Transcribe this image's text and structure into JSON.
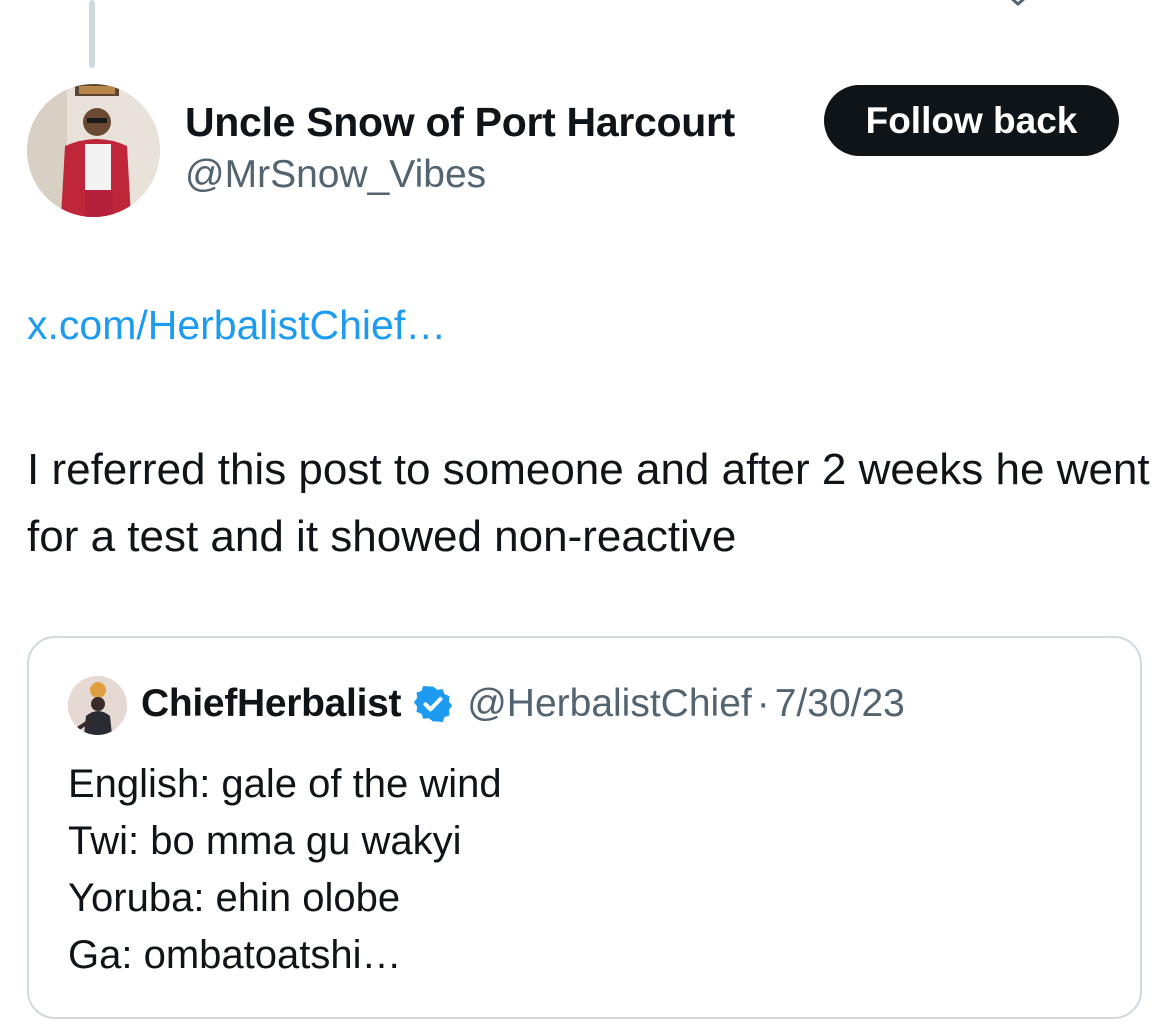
{
  "author": {
    "display_name": "Uncle Snow of Port Harcourt",
    "handle": "@MrSnow_Vibes",
    "follow_label": "Follow back",
    "avatar_icon": "profile-photo"
  },
  "tweet": {
    "link_text": "x.com/HerbalistChief…",
    "text": "I referred this post to someone and after 2 weeks he went for a test and it showed non-reactive"
  },
  "quote": {
    "display_name": "ChiefHerbalist",
    "verified_icon": "verified-badge-icon",
    "handle": "@HerbalistChief",
    "separator": "·",
    "date": "7/30/23",
    "lines": [
      "English: gale of the wind",
      "Twi: bo mma gu wakyi",
      "Yoruba: ehin olobe",
      "Ga: ombatoatshi…"
    ]
  },
  "colors": {
    "link": "#1d9bf0",
    "verified": "#1d9bf0",
    "secondary_text": "#536471",
    "button_bg": "#0f1419"
  }
}
